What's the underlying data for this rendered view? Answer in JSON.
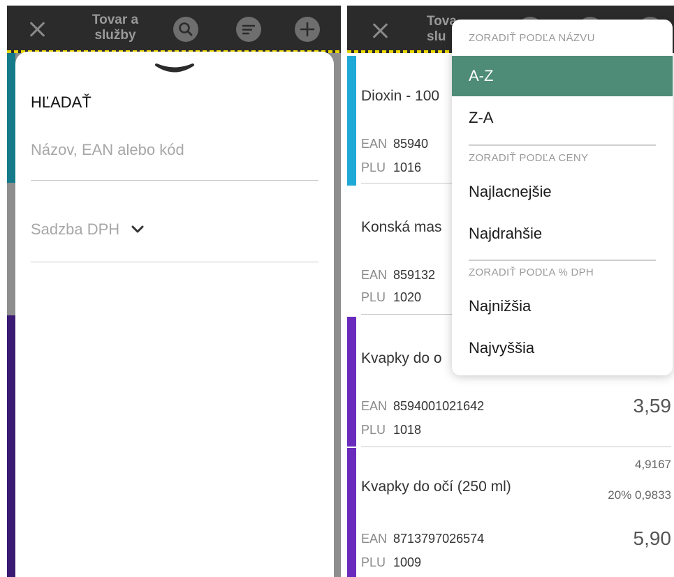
{
  "app": {
    "title_line1": "Tovar a",
    "title_line2": "služby",
    "title_right_line1": "Tova",
    "title_right_line2": "slu"
  },
  "icons": {
    "close": "close-icon",
    "search": "search-icon",
    "sort": "sort-icon",
    "add": "plus-icon",
    "handle": "chevron-down-icon",
    "select_chevron": "chevron-down-icon"
  },
  "search_sheet": {
    "title": "HĽADAŤ",
    "name_placeholder": "Názov, EAN alebo kód",
    "vat_placeholder": "Sadzba DPH"
  },
  "sort_menu": {
    "by_name_header": "ZORADIŤ PODĽA NÁZVU",
    "az": "A-Z",
    "za": "Z-A",
    "by_price_header": "ZORADIŤ PODĽA CENY",
    "cheapest": "Najlacnejšie",
    "most_expensive": "Najdrahšie",
    "by_vat_header": "ZORADIŤ PODĽA % DPH",
    "lowest": "Najnižšia",
    "highest": "Najvyššia",
    "selected": "A-Z"
  },
  "labels": {
    "ean": "EAN",
    "plu": "PLU"
  },
  "items": [
    {
      "name": "Dioxin - 100",
      "ean": "85940",
      "plu": "1016",
      "color": "#1fa9d6"
    },
    {
      "name": "Konská mas",
      "ean": "859132",
      "plu": "1020",
      "color": "#8e8e8e"
    },
    {
      "name": "Kvapky do o",
      "ean": "8594001021642",
      "plu": "1018",
      "price": "3,59",
      "color": "#6a2bbd"
    },
    {
      "name": "Kvapky do očí (250 ml)",
      "ean": "8713797026574",
      "plu": "1009",
      "price": "5,90",
      "net": "4,9167",
      "vat": "20% 0,9833",
      "color": "#6a2bbd"
    }
  ],
  "colors": {
    "accent": "#4e8c78",
    "topbar": "#2b2b2b",
    "stripe": "#e8d400",
    "teal_strip": "#157b8a",
    "gray_strip": "#8e8e8e",
    "purple_strip": "#3b1a73"
  }
}
